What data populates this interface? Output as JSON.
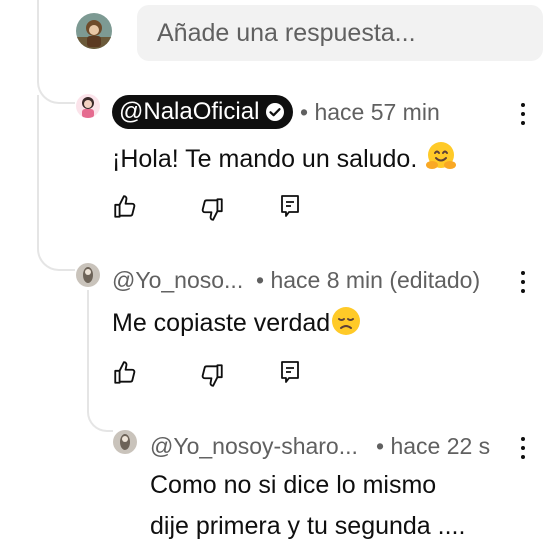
{
  "reply_input": {
    "placeholder": "Añade una respuesta..."
  },
  "comments": [
    {
      "author": "@NalaOficial",
      "is_creator": true,
      "time": "• hace 57 min",
      "text": "¡Hola! Te mando un saludo.",
      "emoji": "hugging-face"
    },
    {
      "author": "@Yo_noso...",
      "time": "• hace 8 min (editado)",
      "text": "Me copiaste verdad",
      "emoji": "disappointed-face"
    },
    {
      "author": "@Yo_nosoy-sharo...",
      "time": "• hace 22 s",
      "text_line1": "Como no si dice lo mismo",
      "text_line2": "dije primera y tu segunda ...."
    }
  ],
  "icons": [
    "thumbs-up-icon",
    "thumbs-down-icon",
    "reply-icon",
    "more-vert-icon",
    "verified-check-icon"
  ],
  "colors": {
    "text": "#0f0f0f",
    "meta": "#606060",
    "input_bg": "#f2f2f2",
    "badge_bg": "#0f0f0f"
  }
}
